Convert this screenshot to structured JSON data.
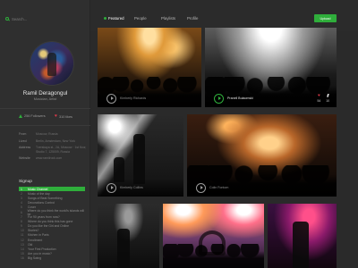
{
  "sidebar": {
    "search_placeholder": "Search...",
    "profile": {
      "name": "Ramil Deragongul",
      "role": "Musician, Artist"
    },
    "stats": {
      "followers": "256 Followers",
      "likes": "310 likes"
    },
    "info": [
      {
        "key": "From",
        "value": "Moscow, Russia"
      },
      {
        "key": "Lived",
        "value": "Berlin, Amsterdam, New York"
      },
      {
        "key": "Address",
        "value": "Tverskaya st., 2A, Moscow · 1st floor, Studio 7, 125009, Russia"
      },
      {
        "key": "Website",
        "value": "www.ramilrock.com"
      }
    ],
    "signup_heading": "Signup",
    "tracks": [
      {
        "n": "1",
        "title": "Music Channel",
        "active": true
      },
      {
        "n": "2",
        "title": "Music of the day",
        "active": false
      },
      {
        "n": "3",
        "title": "Songs of Beat Something",
        "active": false
      },
      {
        "n": "4",
        "title": "Decorations Control",
        "active": false
      },
      {
        "n": "5",
        "title": "Cover",
        "active": false
      },
      {
        "n": "6",
        "title": "Where do you think the world's islands will be",
        "active": false
      },
      {
        "n": "7",
        "title": "For 90 years from now?",
        "active": false
      },
      {
        "n": "8",
        "title": "Where do you think this has gone",
        "active": false
      },
      {
        "n": "9",
        "title": "Do you like the Girl and Online",
        "active": false
      },
      {
        "n": "10",
        "title": "Stories?",
        "active": false
      },
      {
        "n": "11",
        "title": "Kitchen in Paris",
        "active": false
      },
      {
        "n": "12",
        "title": "Enrollment",
        "active": false
      },
      {
        "n": "13",
        "title": "Old",
        "active": false
      },
      {
        "n": "14",
        "title": "Your First Production",
        "active": false
      },
      {
        "n": "15",
        "title": "Are you in music?",
        "active": false
      },
      {
        "n": "16",
        "title": "Big Swing",
        "active": false
      }
    ]
  },
  "topnav": {
    "tabs": [
      "Featured",
      "People",
      "Playlists",
      "Profile"
    ],
    "upload_label": "Upload"
  },
  "tiles": [
    {
      "caption": "Kimberly Richards"
    },
    {
      "caption": "Pranell Bulaomski",
      "likes": "54",
      "bookmarks": "10"
    },
    {
      "caption": "Kimberly Collins"
    },
    {
      "caption": "Colin Fontom"
    }
  ],
  "colors": {
    "accent": "#2fae3b",
    "heart": "#e33b4b",
    "background": "#2a2a2a",
    "sidebar": "#2f2f2f"
  }
}
